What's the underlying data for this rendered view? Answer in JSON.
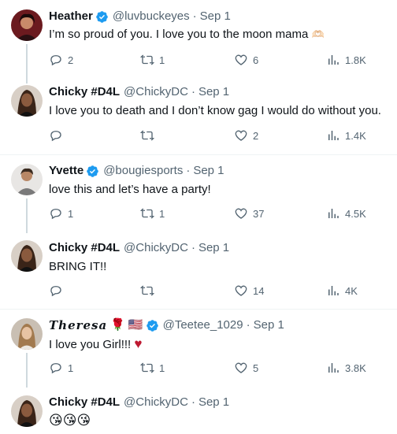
{
  "tweets": [
    {
      "name": "Heather",
      "verified": true,
      "handle": "@luvbuckeyes",
      "separator": "·",
      "date": "Sep 1",
      "text": "I’m so proud of you. I love you to the moon mama",
      "text_emoji": "🫶🏻",
      "replies": "2",
      "retweets": "1",
      "likes": "6",
      "views": "1.8K"
    },
    {
      "name": "Chicky #D4L",
      "verified": false,
      "handle": "@ChickyDC",
      "separator": "·",
      "date": "Sep 1",
      "text": "I love you to death and I don’t know gag I would do without you.",
      "replies": "",
      "retweets": "",
      "likes": "2",
      "views": "1.4K"
    },
    {
      "name": "Yvette",
      "verified": true,
      "handle": "@bougiesports",
      "separator": "·",
      "date": "Sep 1",
      "text": "love this and let’s have a party!",
      "replies": "1",
      "retweets": "1",
      "likes": "37",
      "views": "4.5K"
    },
    {
      "name": "Chicky #D4L",
      "verified": false,
      "handle": "@ChickyDC",
      "separator": "·",
      "date": "Sep 1",
      "text": "BRING IT!!",
      "replies": "",
      "retweets": "",
      "likes": "14",
      "views": "4K"
    },
    {
      "name": "𝑻𝒉𝒆𝒓𝒆𝒔𝒂",
      "name_emoji": "🌹",
      "name_flag": "🇺🇸",
      "verified": true,
      "handle": "@Teetee_1029",
      "separator": "·",
      "date": "Sep 1",
      "text": "I love you Girl!!!",
      "text_emoji": "♥",
      "replies": "1",
      "retweets": "1",
      "likes": "5",
      "views": "3.8K"
    },
    {
      "name": "Chicky #D4L",
      "verified": false,
      "handle": "@ChickyDC",
      "separator": "·",
      "date": "Sep 1",
      "text": "😘😘😘"
    }
  ],
  "colors": {
    "text": "#0f1419",
    "muted": "#536471",
    "verified": "#1d9bf0",
    "thread_line": "#cfd9de",
    "divider": "#eff3f4",
    "heart_red": "#be1931"
  },
  "icons": {
    "reply": "reply-icon",
    "retweet": "retweet-icon",
    "like": "heart-icon",
    "views": "views-icon",
    "verified": "verified-badge-icon"
  }
}
